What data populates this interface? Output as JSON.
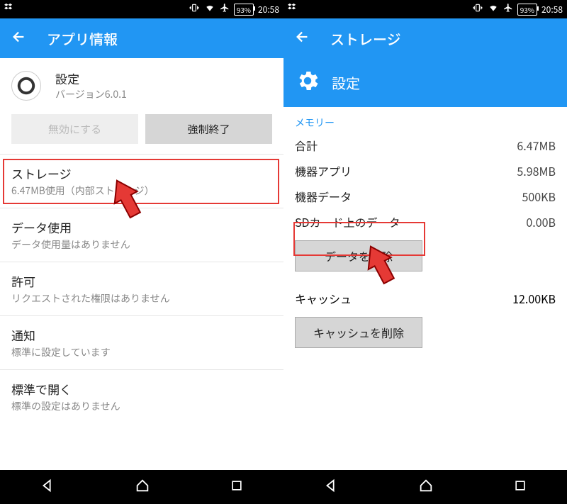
{
  "status": {
    "battery": "93%",
    "time": "20:58"
  },
  "left": {
    "appbar_title": "アプリ情報",
    "app_name": "設定",
    "app_version": "バージョン6.0.1",
    "disable_btn": "無効にする",
    "force_stop_btn": "強制終了",
    "items": [
      {
        "label": "ストレージ",
        "sub": "6.47MB使用（内部ストレージ）"
      },
      {
        "label": "データ使用",
        "sub": "データ使用量はありません"
      },
      {
        "label": "許可",
        "sub": "リクエストされた権限はありません"
      },
      {
        "label": "通知",
        "sub": "標準に設定しています"
      },
      {
        "label": "標準で開く",
        "sub": "標準の設定はありません"
      }
    ]
  },
  "right": {
    "appbar_title": "ストレージ",
    "header_title": "設定",
    "section_label": "メモリー",
    "rows": [
      {
        "k": "合計",
        "v": "6.47MB"
      },
      {
        "k": "機器アプリ",
        "v": "5.98MB"
      },
      {
        "k": "機器データ",
        "v": "500KB"
      },
      {
        "k": "SDカード上のデータ",
        "v": "0.00B"
      }
    ],
    "clear_data_btn": "データを削除",
    "cache_label": "キャッシュ",
    "cache_value": "12.00KB",
    "clear_cache_btn": "キャッシュを削除"
  }
}
